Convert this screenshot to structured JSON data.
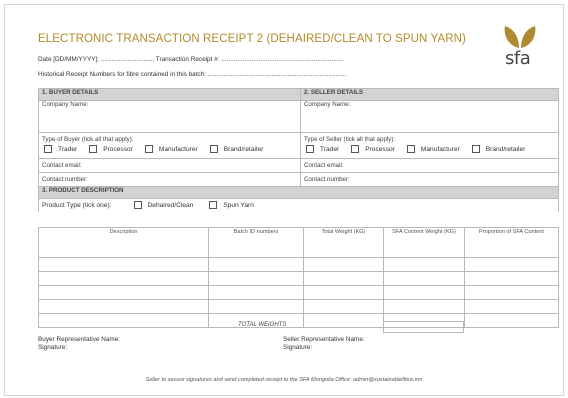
{
  "header": {
    "title": "ELECTRONIC TRANSACTION RECEIPT 2 (DEHAIRED/CLEAN TO SPUN YARN)",
    "date_line": "Date [DD/MM/YYYY]: ..............................    Transaction Receipt #: .....................................................................",
    "historical_line": "Historical Receipt Numbers for fibre contained in this batch: ..............................................................................",
    "logo_text": "sfa",
    "logo_color": "#b08a32"
  },
  "buyer": {
    "section": "1.   BUYER DETAILS",
    "company": "Company Name:",
    "type_label": "Type of Buyer (tick all that apply):",
    "types": [
      "Trader",
      "Processor",
      "Manufacturer",
      "Brand/retailer"
    ],
    "email": "Contact email:",
    "number": "Contact number:"
  },
  "seller": {
    "section": "2.   SELLER DETAILS",
    "company": "Company Name:",
    "type_label": "Type of Seller (tick all that apply):",
    "types": [
      "Trader",
      "Processor",
      "Manufacturer",
      "Brand/retailer"
    ],
    "email": "Contact email:",
    "number": "Contact number:"
  },
  "product": {
    "section": "3.   PRODUCT DESCRIPTION",
    "type_label": "Product Type (tick one):",
    "types": [
      "Dehaired/Clean",
      "Spun Yarn"
    ],
    "columns": [
      "Description",
      "Batch ID numbers",
      "Total Weight (KG)",
      "SFA Content Weight (KG)",
      "Proportion of SFA Content"
    ],
    "total_label": "TOTAL WEIGHTS"
  },
  "signatures": {
    "buyer_name": "Buyer Representative Name:",
    "buyer_sig": "Signature:",
    "seller_name": "Seller Representative Name:",
    "seller_sig": "Signature:"
  },
  "footer": "Seller to secure signatures and send completed receipt to the SFA Mongolia Office: admin@sustainablefibre.mn"
}
